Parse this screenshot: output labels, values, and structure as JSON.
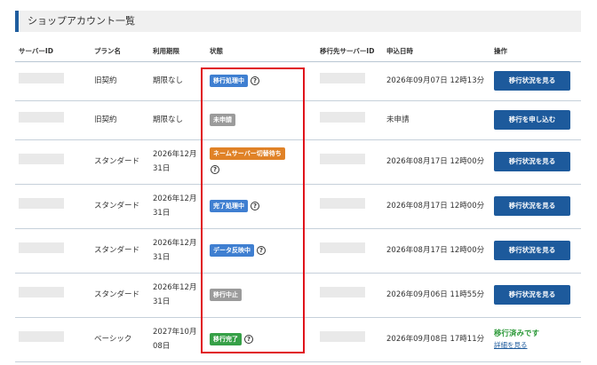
{
  "page": {
    "title": "ショップアカウント一覧"
  },
  "colors": {
    "accent": "#1d5a9c",
    "status_blue": "#3f7fd1",
    "status_gray": "#9b9b9b",
    "status_orange": "#e08227",
    "status_green": "#36a047",
    "done_green": "#2e9a3a",
    "highlight_red": "#e0121b"
  },
  "table": {
    "headers": {
      "server_id": "サーバーID",
      "plan": "プラン名",
      "expiry": "利用期限",
      "status": "状態",
      "dest_server_id": "移行先サーバーID",
      "applied_at": "申込日時",
      "action": "操作"
    },
    "rows": [
      {
        "plan": "旧契約",
        "expiry": "期限なし",
        "status": "移行処理中",
        "status_color": "blue",
        "applied_at": "2026年09月07日 12時13分",
        "action": "移行状況を見る"
      },
      {
        "plan": "旧契約",
        "expiry": "期限なし",
        "status": "未申請",
        "status_color": "gray",
        "applied_at": "未申請",
        "action": "移行を申し込む"
      },
      {
        "plan": "スタンダード",
        "expiry": "2026年12月31日",
        "status": "ネームサーバー切替待ち",
        "status_color": "orange",
        "applied_at": "2026年08月17日 12時00分",
        "action": "移行状況を見る"
      },
      {
        "plan": "スタンダード",
        "expiry": "2026年12月31日",
        "status": "完了処理中",
        "status_color": "blue",
        "applied_at": "2026年08月17日 12時00分",
        "action": "移行状況を見る"
      },
      {
        "plan": "スタンダード",
        "expiry": "2026年12月31日",
        "status": "データ反映中",
        "status_color": "blue",
        "applied_at": "2026年08月17日 12時00分",
        "action": "移行状況を見る"
      },
      {
        "plan": "スタンダード",
        "expiry": "2026年12月31日",
        "status": "移行中止",
        "status_color": "gray",
        "applied_at": "2026年09月06日 11時55分",
        "action": "移行状況を見る"
      },
      {
        "plan": "ベーシック",
        "expiry": "2027年10月08日",
        "status": "移行完了",
        "status_color": "green",
        "applied_at": "2026年09月08日 17時11分",
        "action_done_text": "移行済みです",
        "action_link": "詳細を見る"
      }
    ]
  },
  "icons": {
    "help": "help-circle-icon"
  },
  "help_glyph": "?"
}
